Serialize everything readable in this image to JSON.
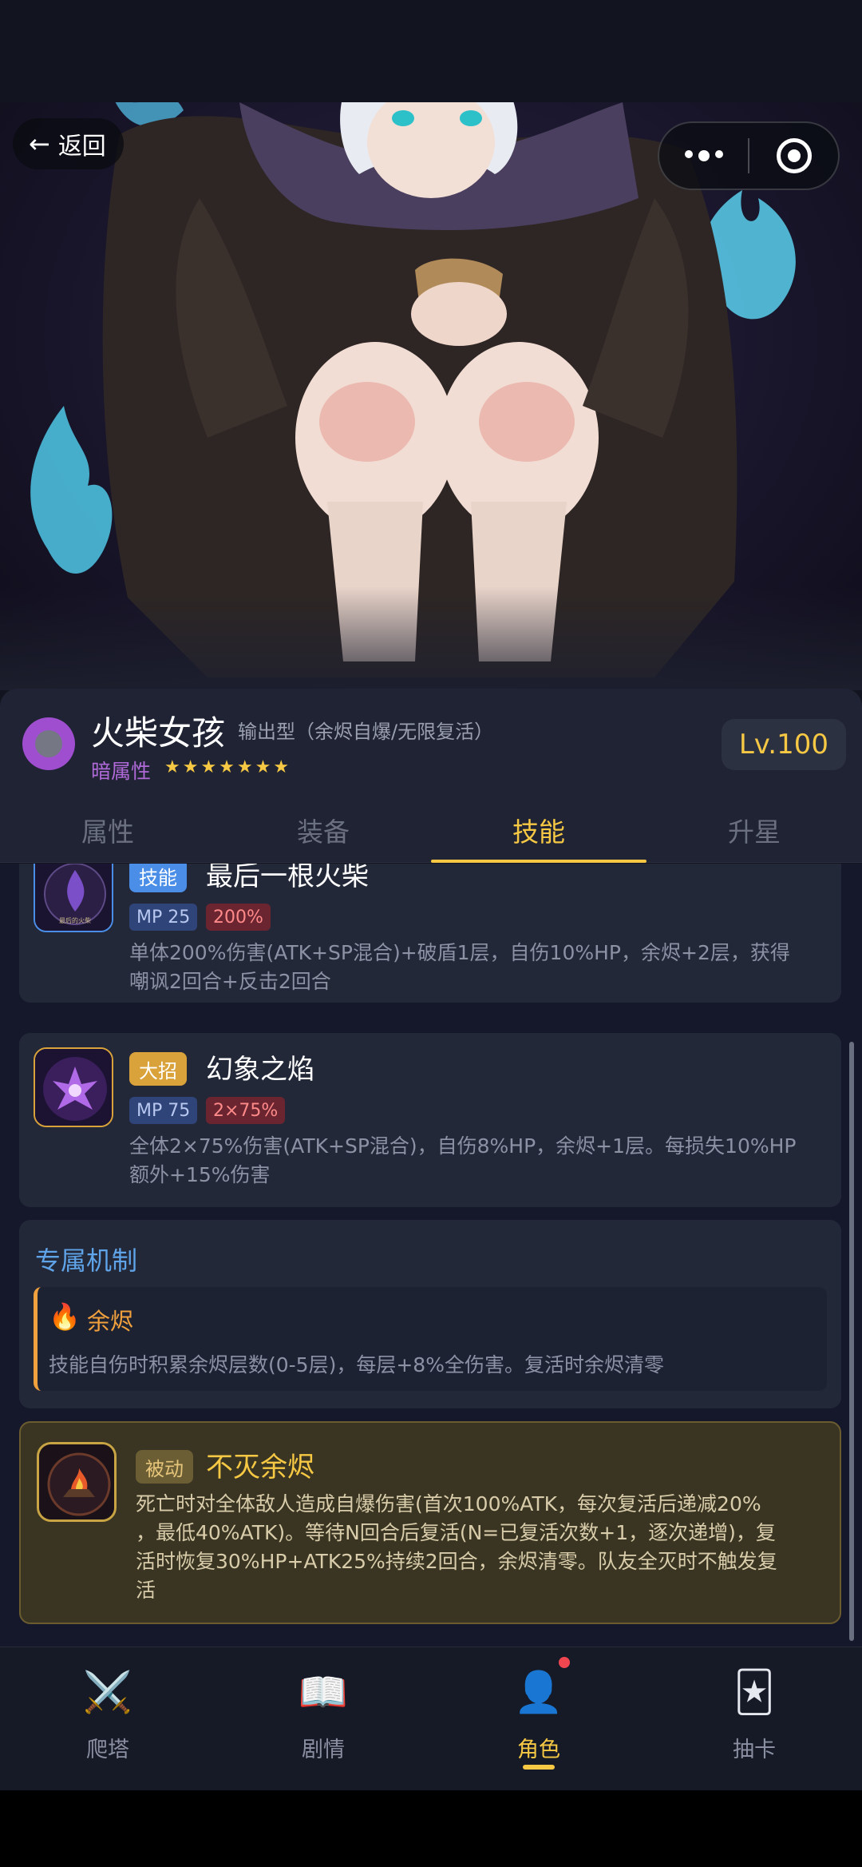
{
  "header": {
    "back_label": "返回",
    "back_arrow": "←"
  },
  "character": {
    "name": "火柴女孩",
    "type": "输出型（余烬自爆/无限复活）",
    "attribute": "暗属性",
    "stars": "★★★★★★★",
    "star_count": 7,
    "level": "Lv.100"
  },
  "tabs": [
    {
      "label": "属性"
    },
    {
      "label": "装备"
    },
    {
      "label": "技能"
    },
    {
      "label": "升星"
    }
  ],
  "active_tab": "技能",
  "skills": [
    {
      "tag": "技能",
      "name": "最后一根火柴",
      "mp": "MP 25",
      "multiplier": "200%",
      "desc_line1": "单体200%伤害(ATK+SP混合)+破盾1层，自伤10%HP，余烬+2层，获得",
      "desc_line2": "嘲讽2回合+反击2回合",
      "icon_caption": "最后的火柴"
    },
    {
      "tag": "大招",
      "name": "幻象之焰",
      "mp": "MP 75",
      "multiplier": "2×75%",
      "desc_line1": "全体2×75%伤害(ATK+SP混合)，自伤8%HP，余烬+1层。每损失10%HP",
      "desc_line2": "额外+15%伤害"
    }
  ],
  "mechanic": {
    "section_title": "专属机制",
    "icon": "🔥",
    "name": "余烬",
    "desc": "技能自伤时积累余烬层数(0-5层)，每层+8%全伤害。复活时余烬清零"
  },
  "passive": {
    "tag": "被动",
    "name": "不灭余烬",
    "desc_line1": "死亡时对全体敌人造成自爆伤害(首次100%ATK，每次复活后递减20%",
    "desc_line2": "，最低40%ATK)。等待N回合后复活(N=已复活次数+1，逐次递增)，复",
    "desc_line3": "活时恢复30%HP+ATK25%持续2回合，余烬清零。队友全灭时不触发复",
    "desc_line4": "活"
  },
  "bottom_nav": [
    {
      "label": "爬塔",
      "icon": "⚔️"
    },
    {
      "label": "剧情",
      "icon": "📖"
    },
    {
      "label": "角色",
      "icon": "👤"
    },
    {
      "label": "抽卡",
      "icon": "🃏"
    }
  ],
  "colors": {
    "gold": "#f6c844",
    "dark_purple": "#b06ad8",
    "skill_blue": "#4a8ee8",
    "ult_orange": "#d9a23a",
    "ember_orange": "#f0a03c"
  }
}
